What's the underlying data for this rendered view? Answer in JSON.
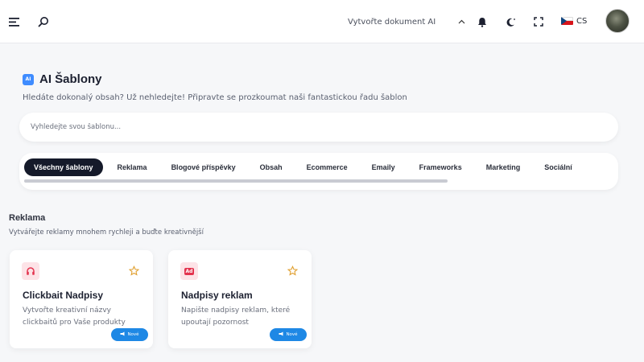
{
  "topbar": {
    "create_document": "Vytvořte dokument AI",
    "language": "CS",
    "icons": [
      "menu-icon",
      "search-icon",
      "chevron-up-icon",
      "bell-icon",
      "moon-icon",
      "fullscreen-icon",
      "flag-cz-icon",
      "avatar"
    ]
  },
  "header": {
    "badge": "AI",
    "title": "AI Šablony",
    "subtitle": "Hledáte dokonalý obsah? Už nehledejte! Připravte se prozkoumat naši fantastickou řadu šablon"
  },
  "search": {
    "placeholder": "Vyhledejte svou šablonu..."
  },
  "tabs": [
    {
      "label": "Všechny šablony",
      "active": true
    },
    {
      "label": "Reklama",
      "active": false
    },
    {
      "label": "Blogové příspěvky",
      "active": false
    },
    {
      "label": "Obsah",
      "active": false
    },
    {
      "label": "Ecommerce",
      "active": false
    },
    {
      "label": "Emaily",
      "active": false
    },
    {
      "label": "Frameworks",
      "active": false
    },
    {
      "label": "Marketing",
      "active": false
    },
    {
      "label": "Sociální",
      "active": false
    }
  ],
  "section": {
    "title": "Reklama",
    "subtitle": "Vytvářejte reklamy mnohem rychleji a buďte kreativnější"
  },
  "cards": [
    {
      "icon": "headphones-icon",
      "title": "Clickbait Nadpisy",
      "description": "Vytvořte kreativní názvy clickbaitů pro Vaše produkty",
      "badge": "Nové"
    },
    {
      "icon": "ad-icon",
      "icon_text": "Ad",
      "title": "Nadpisy reklam",
      "description": "Napište nadpisy reklam, které upoutají pozornost",
      "badge": "Nové"
    }
  ],
  "colors": {
    "accent": "#1e88e5",
    "active_tab": "#151a2a",
    "icon_red": "#e3334e",
    "star": "#e0a030"
  }
}
